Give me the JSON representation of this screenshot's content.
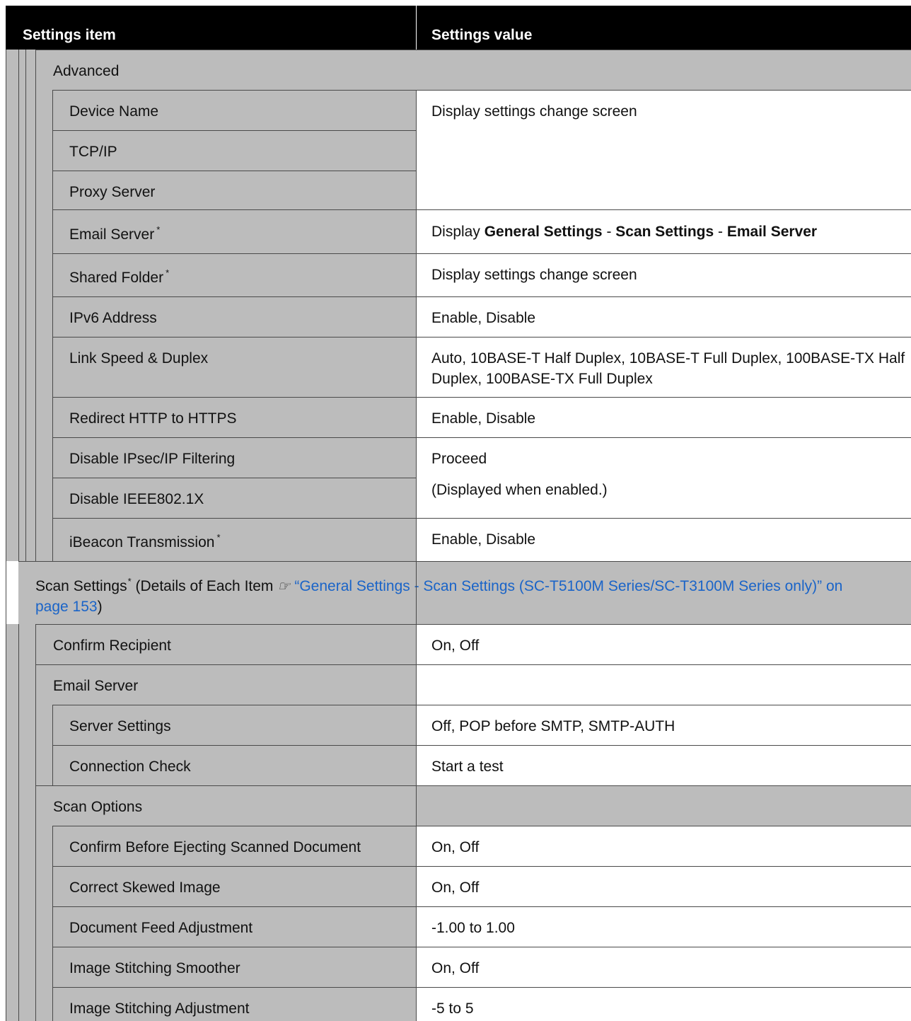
{
  "header": {
    "col_item": "Settings item",
    "col_value": "Settings value"
  },
  "advanced": {
    "label": "Advanced",
    "items": {
      "device_name": "Device Name",
      "tcpip": "TCP/IP",
      "proxy": "Proxy Server",
      "email_server": "Email Server",
      "shared_folder": "Shared Folder",
      "ipv6": "IPv6 Address",
      "link_speed": "Link Speed & Duplex",
      "redirect": "Redirect HTTP to HTTPS",
      "disable_ipsec": "Disable IPsec/IP Filtering",
      "disable_ieee": "Disable IEEE802.1X",
      "ibeacon": "iBeacon Transmission"
    },
    "values": {
      "display_change": "Display settings change screen",
      "email_display": "Display",
      "email_path_1": "General Settings",
      "email_path_2": "Scan Settings",
      "email_path_3": "Email Server",
      "path_sep": "-",
      "shared_folder": "Display settings change screen",
      "ipv6": "Enable, Disable",
      "link_speed_line1": "Auto, 10BASE-T Half Duplex, 10BASE-T Full Duplex, 100BASE-TX Half",
      "link_speed_line2": "Duplex, 100BASE-TX Full Duplex",
      "redirect": "Enable, Disable",
      "proceed": "Proceed",
      "proceed_note": "(Displayed when enabled.)",
      "ibeacon": "Enable, Disable"
    },
    "asterisk": "*"
  },
  "scan_settings": {
    "label": "Scan Settings",
    "details_prefix": "(Details of Each Item",
    "ref_icon": "pointing-hand-icon",
    "link_line1": "“General Settings - Scan Settings (SC-T5100M Series/SC-T3100M Series only)” on",
    "link_line2": "page 153",
    "close_paren": ")",
    "confirm_recipient": "Confirm Recipient",
    "confirm_recipient_value": "On, Off",
    "email_server": "Email Server",
    "server_settings": "Server Settings",
    "server_settings_value": "Off, POP before SMTP, SMTP-AUTH",
    "connection_check": "Connection Check",
    "connection_check_value": "Start a test",
    "scan_options": "Scan Options",
    "options": {
      "confirm_eject": "Confirm Before Ejecting Scanned Document",
      "confirm_eject_value": "On, Off",
      "correct_skew": "Correct Skewed Image",
      "correct_skew_value": "On, Off",
      "feed_adjust": "Document Feed Adjustment",
      "feed_adjust_value": "-1.00 to 1.00",
      "stitch_smoother": "Image Stitching Smoother",
      "stitch_smoother_value": "On, Off",
      "stitch_adjust": "Image Stitching Adjustment",
      "stitch_adjust_value": "-5 to 5"
    }
  }
}
